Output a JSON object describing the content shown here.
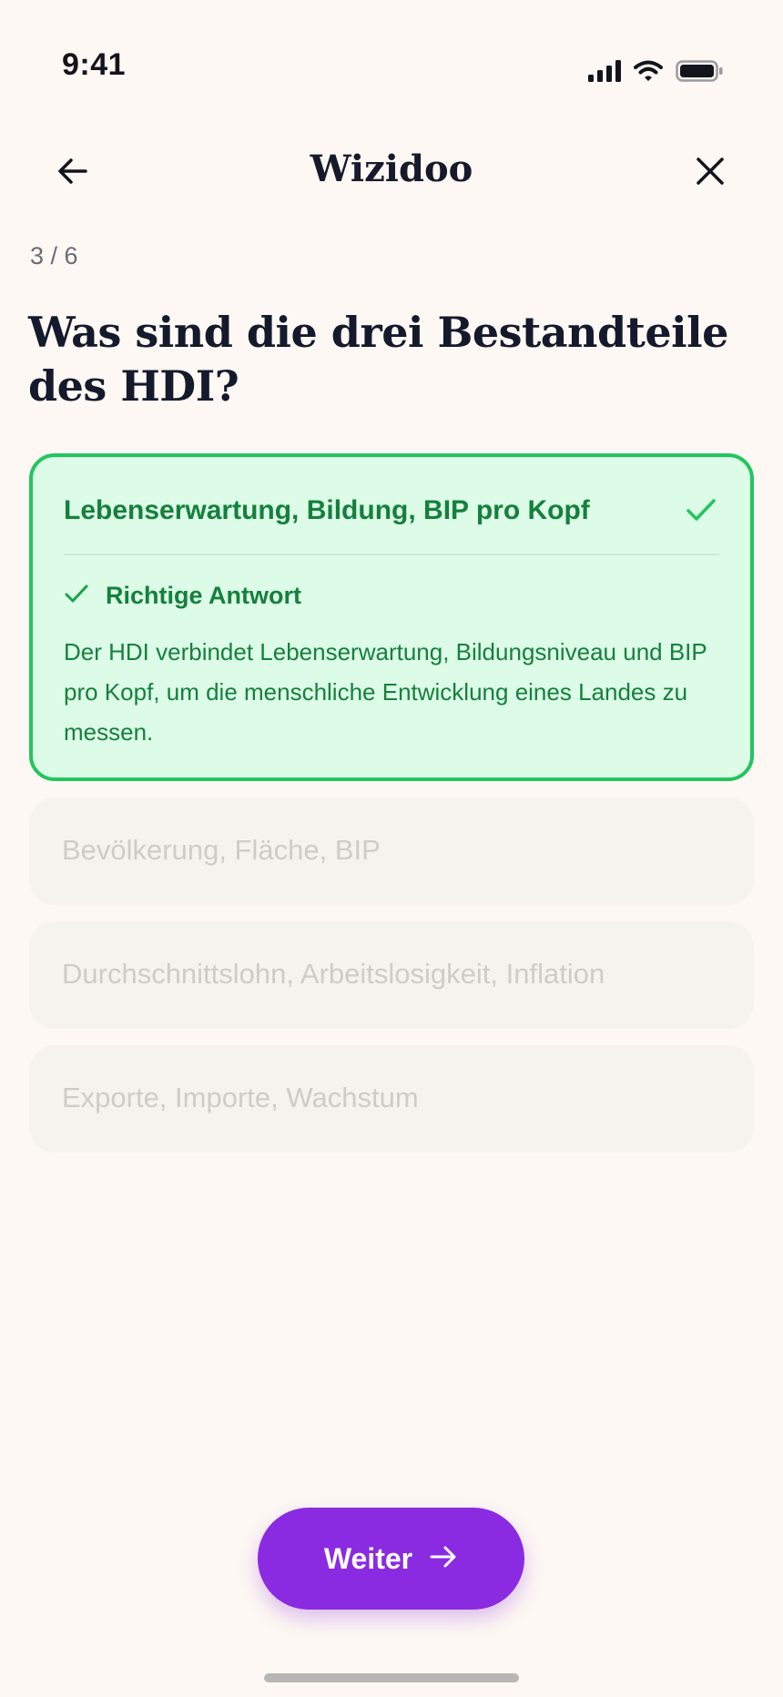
{
  "status_bar": {
    "time": "9:41",
    "icons": [
      "signal-icon",
      "wifi-icon",
      "battery-icon"
    ]
  },
  "header": {
    "title": "Wizidoo",
    "back_icon": "arrow-left-icon",
    "close_icon": "close-icon"
  },
  "quiz": {
    "progress": "3 / 6",
    "question": "Was sind die drei Bestandteile des HDI?",
    "answers": [
      {
        "label": "Lebenserwartung, Bildung, BIP pro Kopf",
        "state": "correct"
      },
      {
        "label": "Bevölkerung, Fläche, BIP",
        "state": "disabled"
      },
      {
        "label": "Durchschnittslohn, Arbeitslosigkeit, Inflation",
        "state": "disabled"
      },
      {
        "label": "Exporte, Importe, Wachstum",
        "state": "disabled"
      }
    ],
    "feedback": {
      "title": "Richtige Antwort",
      "text": "Der HDI verbindet Lebenserwartung, Bildungsniveau und BIP pro Kopf, um die menschliche Entwicklung eines Landes zu messen."
    }
  },
  "footer": {
    "next_label": "Weiter",
    "next_icon": "arrow-right-icon"
  },
  "colors": {
    "background": "#fdf8f3",
    "correct_bg": "#dcfce7",
    "correct_border": "#22c55e",
    "correct_text": "#15803d",
    "primary": "#8a2be2"
  }
}
